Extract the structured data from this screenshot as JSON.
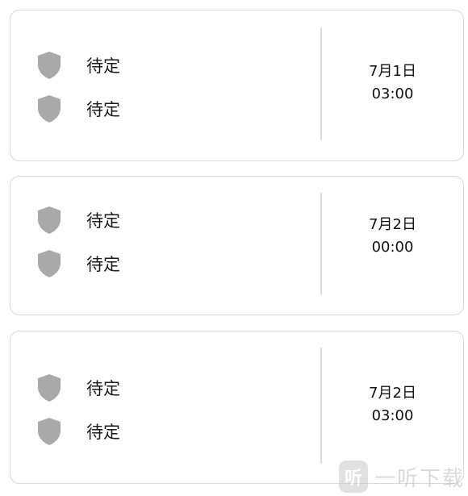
{
  "matches": [
    {
      "teams": [
        {
          "name": "待定",
          "icon": "shield-icon"
        },
        {
          "name": "待定",
          "icon": "shield-icon"
        }
      ],
      "date": "7月1日",
      "time": "03:00"
    },
    {
      "teams": [
        {
          "name": "待定",
          "icon": "shield-icon"
        },
        {
          "name": "待定",
          "icon": "shield-icon"
        }
      ],
      "date": "7月2日",
      "time": "00:00"
    },
    {
      "teams": [
        {
          "name": "待定",
          "icon": "shield-icon"
        },
        {
          "name": "待定",
          "icon": "shield-icon"
        }
      ],
      "date": "7月2日",
      "time": "03:00"
    }
  ],
  "watermark": {
    "logo_glyph": "听",
    "text": "一听下载"
  },
  "colors": {
    "shield": "#a9a9a9",
    "card_border": "#d9d9d9",
    "divider": "#dcdcdc"
  }
}
